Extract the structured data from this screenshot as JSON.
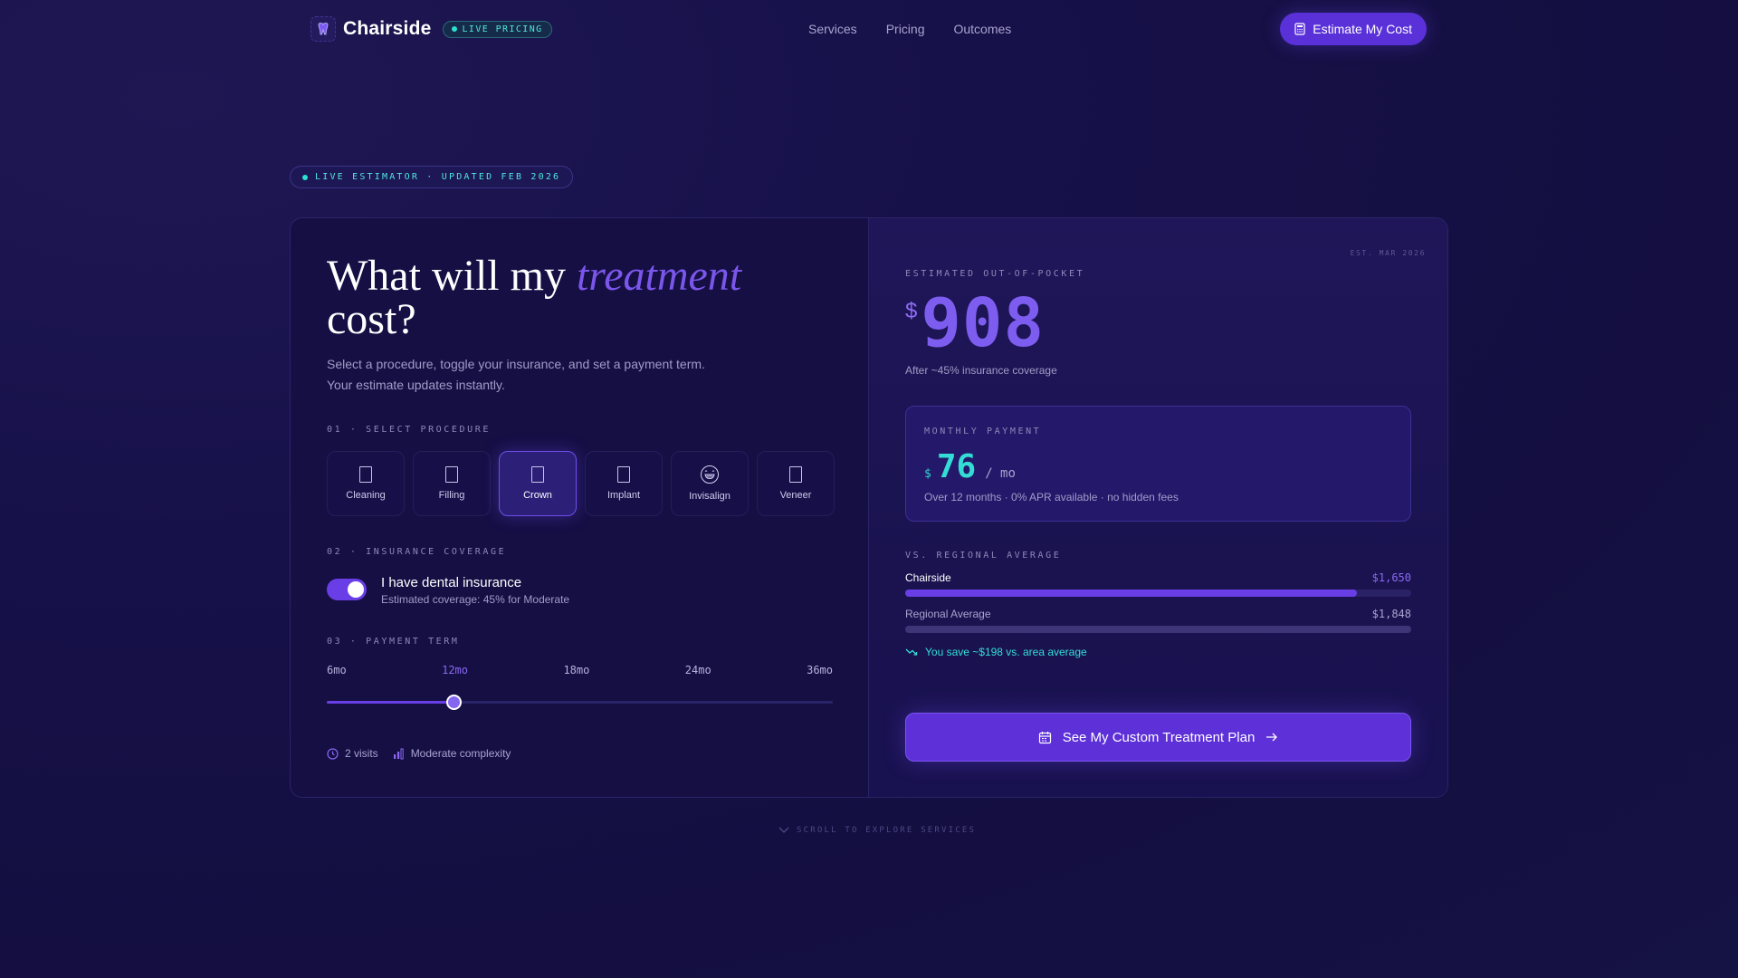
{
  "nav": {
    "brand": "Chairside",
    "badge": "LIVE PRICING",
    "links": [
      "Services",
      "Pricing",
      "Outcomes"
    ],
    "cta": "Estimate My Cost"
  },
  "estimator_pill": "LIVE ESTIMATOR · UPDATED FEB 2026",
  "left": {
    "headline_1": "What will my ",
    "headline_em": "treatment",
    "headline_2": "cost?",
    "subtext": "Select a procedure, toggle your insurance, and set a payment term. Your estimate updates instantly.",
    "section1": "01 · SELECT PROCEDURE",
    "procedures": [
      "Cleaning",
      "Filling",
      "Crown",
      "Implant",
      "Invisalign",
      "Veneer"
    ],
    "selected_procedure": "Crown",
    "section2": "02 · INSURANCE COVERAGE",
    "insurance_title": "I have dental insurance",
    "insurance_sub": "Estimated coverage: 45% for Moderate",
    "insurance_on": true,
    "section3": "03 · PAYMENT TERM",
    "terms": [
      "6mo",
      "12mo",
      "18mo",
      "24mo",
      "36mo"
    ],
    "selected_term": "12mo",
    "term_fraction": 0.25,
    "meta_visits": "2 visits",
    "meta_complexity": "Moderate complexity"
  },
  "right": {
    "est_date": "EST. MAR 2026",
    "estimated_label": "ESTIMATED OUT-OF-POCKET",
    "currency": "$",
    "amount": "908",
    "after": "After ~45% insurance coverage",
    "monthly_label": "MONTHLY PAYMENT",
    "monthly_currency": "$",
    "monthly_amount": "76",
    "monthly_unit": "/ mo",
    "monthly_sub": "Over 12 months · 0% APR available · no hidden fees",
    "vs_label": "VS. REGIONAL AVERAGE",
    "bars": [
      {
        "name": "Chairside",
        "value": "$1,650",
        "fraction": 0.892,
        "color": "#6a3ee6"
      },
      {
        "name": "Regional Average",
        "value": "$1,848",
        "fraction": 1.0,
        "color": "#3d3578"
      }
    ],
    "save_text": "You save ~$198 vs. area average",
    "cta": "See My Custom Treatment Plan"
  },
  "scroll_hint": "SCROLL TO EXPLORE SERVICES"
}
